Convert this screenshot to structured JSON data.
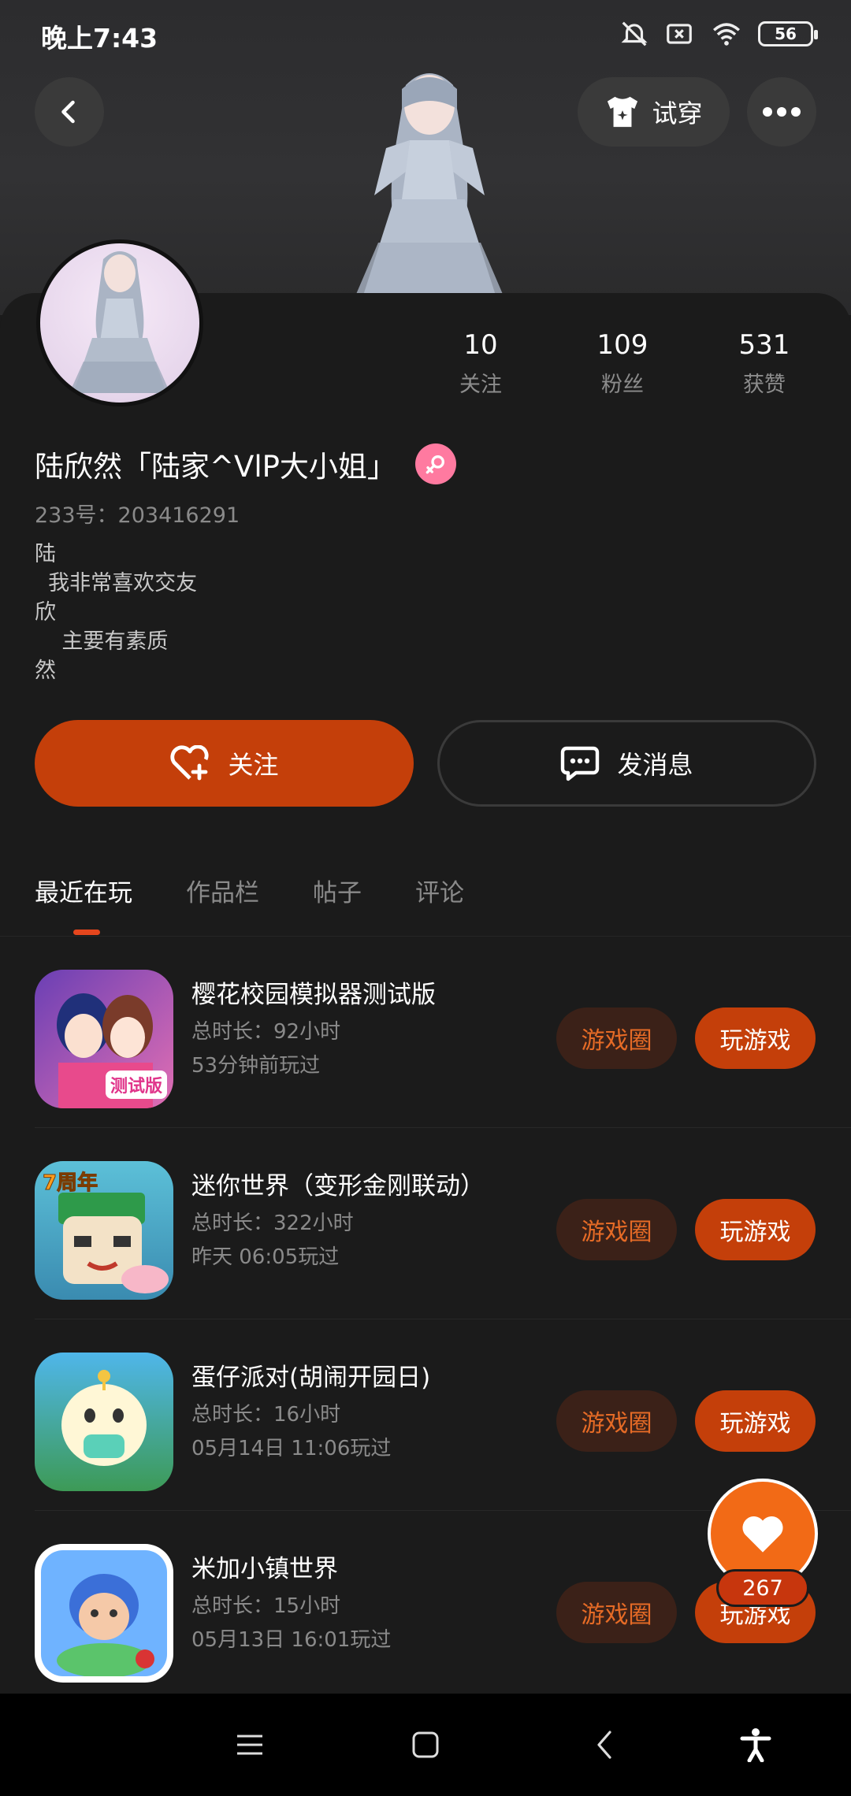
{
  "status_bar": {
    "time": "晚上7:43",
    "battery": "56"
  },
  "header": {
    "tryon_label": "试穿"
  },
  "profile": {
    "stats": [
      {
        "num": "10",
        "label": "关注"
      },
      {
        "num": "109",
        "label": "粉丝"
      },
      {
        "num": "531",
        "label": "获赞"
      }
    ],
    "nickname": "陆欣然「陆家^VlP大小姐」",
    "uid": "233号：203416291",
    "bio": "陆\n  我非常喜欢交友\n欣\n    主要有素质\n然"
  },
  "actions": {
    "follow": "关注",
    "message": "发消息"
  },
  "tabs": [
    "最近在玩",
    "作品栏",
    "帖子",
    "评论"
  ],
  "games": [
    {
      "name": "樱花校园模拟器测试版",
      "duration": "总时长：92小时",
      "last": "53分钟前玩过",
      "circle": "游戏圈",
      "play": "玩游戏"
    },
    {
      "name": "迷你世界（变形金刚联动）",
      "duration": "总时长：322小时",
      "last": "昨天 06:05玩过",
      "circle": "游戏圈",
      "play": "玩游戏"
    },
    {
      "name": "蛋仔派对(胡闹开园日)",
      "duration": "总时长：16小时",
      "last": "05月14日 11:06玩过",
      "circle": "游戏圈",
      "play": "玩游戏"
    },
    {
      "name": "米加小镇世界",
      "duration": "总时长：15小时",
      "last": "05月13日 16:01玩过",
      "circle": "游戏圈",
      "play": "玩游戏"
    }
  ],
  "game_icon_text": {
    "badge_test": "测试版",
    "badge_7th": "7周年"
  },
  "like_fab": {
    "count": "267"
  },
  "colors": {
    "accent": "#c43f0a",
    "circle_bg": "#3b2118",
    "circle_text": "#e66b26",
    "like": "#f26a16"
  }
}
